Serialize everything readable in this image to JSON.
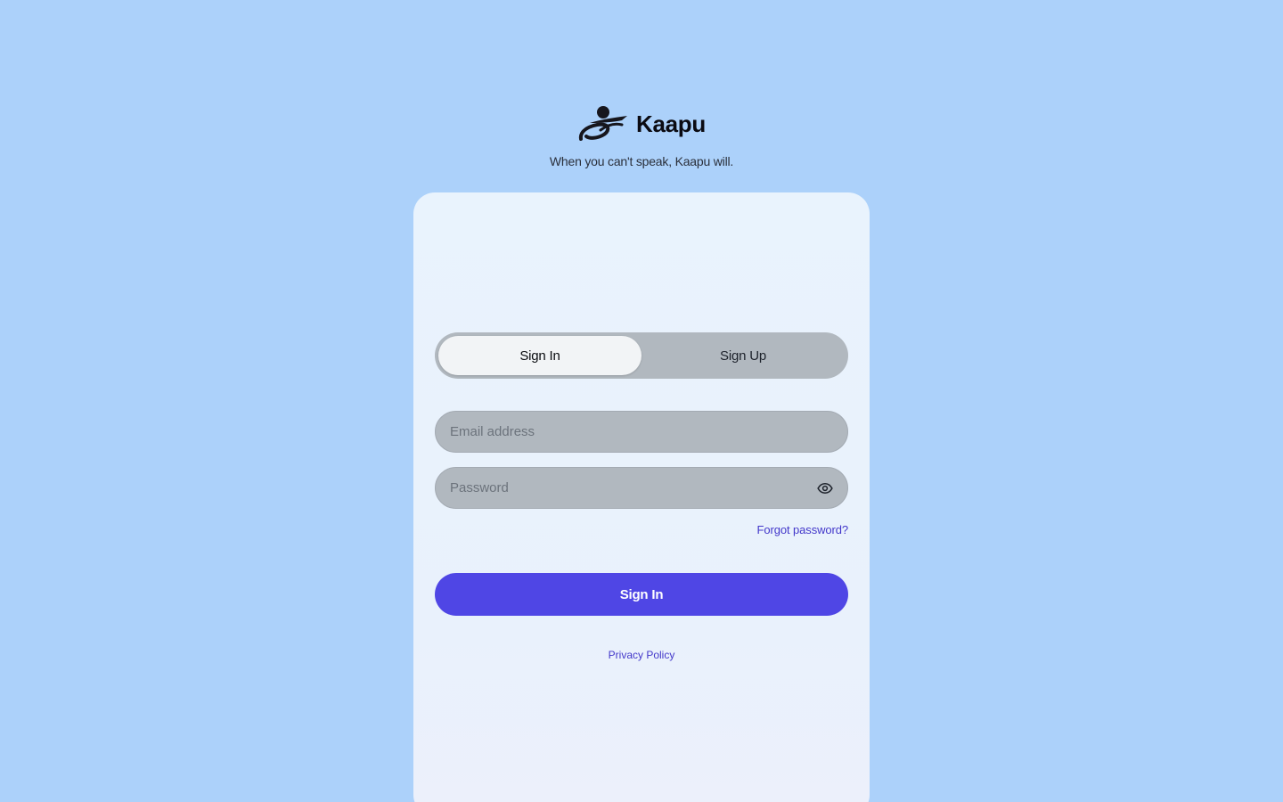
{
  "brand": {
    "logo_icon": "kaapu-logo-icon",
    "name": "Kaapu",
    "tagline": "When you can't speak, Kaapu will."
  },
  "auth": {
    "tabs": [
      {
        "label": "Sign In",
        "active": true
      },
      {
        "label": "Sign Up",
        "active": false
      }
    ],
    "email": {
      "placeholder": "Email address",
      "value": ""
    },
    "password": {
      "placeholder": "Password",
      "value": "",
      "toggle_icon": "eye-icon"
    },
    "forgot_label": "Forgot password?",
    "submit_label": "Sign In",
    "privacy_label": "Privacy Policy"
  },
  "colors": {
    "background": "#acd1fa",
    "card": "#e9f3fd",
    "accent": "#4f46e5",
    "link": "#4338ca",
    "field": "#b1b8bf"
  }
}
